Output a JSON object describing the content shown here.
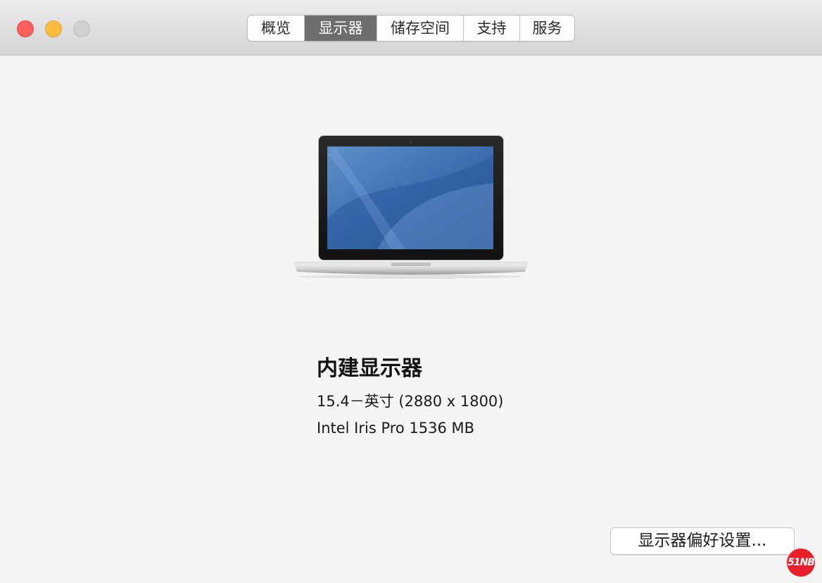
{
  "window": {
    "traffic_lights": [
      "close",
      "minimize",
      "maximize"
    ]
  },
  "tabs": [
    {
      "label": "概览",
      "active": false
    },
    {
      "label": "显示器",
      "active": true
    },
    {
      "label": "储存空间",
      "active": false
    },
    {
      "label": "支持",
      "active": false
    },
    {
      "label": "服务",
      "active": false
    }
  ],
  "display": {
    "icon": "macbook-pro-laptop-icon",
    "name": "内建显示器",
    "size": "15.4－英寸 (2880 x 1800)",
    "graphics": "Intel Iris Pro 1536 MB"
  },
  "footer": {
    "preferences_button": "显示器偏好设置..."
  },
  "watermark": {
    "text": "51NB",
    "color": "#e8202a"
  },
  "colors": {
    "close": "#fc605c",
    "minimize": "#fdbc40",
    "maximize_disabled": "#d0d0d0",
    "tab_active": "#6d6d6d",
    "background": "#f5f5f5"
  }
}
